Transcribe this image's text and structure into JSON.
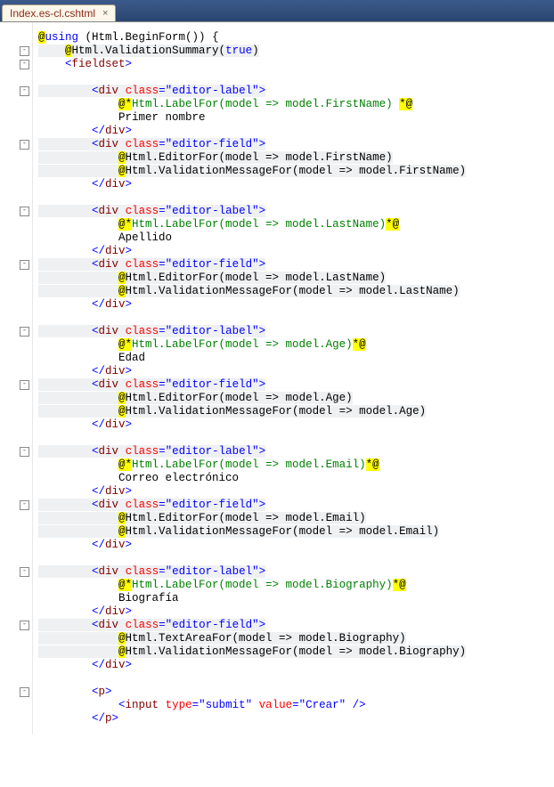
{
  "tab": {
    "filename": "Index.es-cl.cshtml"
  },
  "code": {
    "l1": "@using (Html.BeginForm()) {",
    "l2": "    @Html.ValidationSummary(true)",
    "l3": "    <fieldset>",
    "l4": "",
    "l5a": "        <div class=\"editor-label\">",
    "l6": "            @*Html.LabelFor(model => model.FirstName) *@",
    "l7": "            Primer nombre",
    "l8": "        </div>",
    "l9a": "        <div class=\"editor-field\">",
    "l10": "            @Html.EditorFor(model => model.FirstName)",
    "l11": "            @Html.ValidationMessageFor(model => model.FirstName)",
    "l12": "        </div>",
    "l13": "",
    "l14a": "        <div class=\"editor-label\">",
    "l15": "            @*Html.LabelFor(model => model.LastName)*@",
    "l16": "            Apellido",
    "l17": "        </div>",
    "l18a": "        <div class=\"editor-field\">",
    "l19": "            @Html.EditorFor(model => model.LastName)",
    "l20": "            @Html.ValidationMessageFor(model => model.LastName)",
    "l21": "        </div>",
    "l22": "",
    "l23a": "        <div class=\"editor-label\">",
    "l24": "            @*Html.LabelFor(model => model.Age)*@",
    "l25": "            Edad",
    "l26": "        </div>",
    "l27a": "        <div class=\"editor-field\">",
    "l28": "            @Html.EditorFor(model => model.Age)",
    "l29": "            @Html.ValidationMessageFor(model => model.Age)",
    "l30": "        </div>",
    "l31": "",
    "l32a": "        <div class=\"editor-label\">",
    "l33": "            @*Html.LabelFor(model => model.Email)*@",
    "l34": "            Correo electrónico",
    "l35": "        </div>",
    "l36a": "        <div class=\"editor-field\">",
    "l37": "            @Html.EditorFor(model => model.Email)",
    "l38": "            @Html.ValidationMessageFor(model => model.Email)",
    "l39": "        </div>",
    "l40": "",
    "l41a": "        <div class=\"editor-label\">",
    "l42": "            @*Html.LabelFor(model => model.Biography)*@",
    "l43": "            Biografía",
    "l44": "        </div>",
    "l45a": "        <div class=\"editor-field\">",
    "l46": "            @Html.TextAreaFor(model => model.Biography)",
    "l47": "            @Html.ValidationMessageFor(model => model.Biography)",
    "l48": "        </div>",
    "l49": "",
    "l50": "        <p>",
    "l51": "            <input type=\"submit\" value=\"Crear\" />",
    "l52": "        </p>"
  },
  "fold_symbol": "-"
}
